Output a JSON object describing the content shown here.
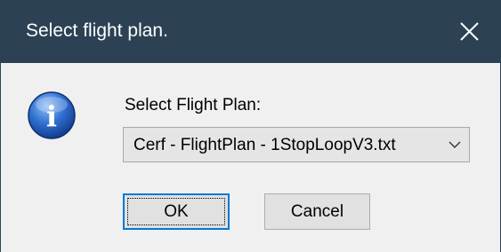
{
  "window": {
    "title": "Select flight plan.",
    "close_icon": "close-icon"
  },
  "dialog": {
    "icon": "info-icon",
    "icon_glyph": "i",
    "prompt": "Select Flight Plan:",
    "select": {
      "value": "Cerf - FlightPlan - 1StopLoopV3.txt",
      "chevron_icon": "chevron-down-icon"
    }
  },
  "buttons": {
    "ok_label": "OK",
    "cancel_label": "Cancel"
  },
  "colors": {
    "titlebar": "#2c4254",
    "dialog_bg": "#f0f0f0",
    "focus_border": "#0078d7",
    "info_icon_blue": "#1f5fb8"
  }
}
